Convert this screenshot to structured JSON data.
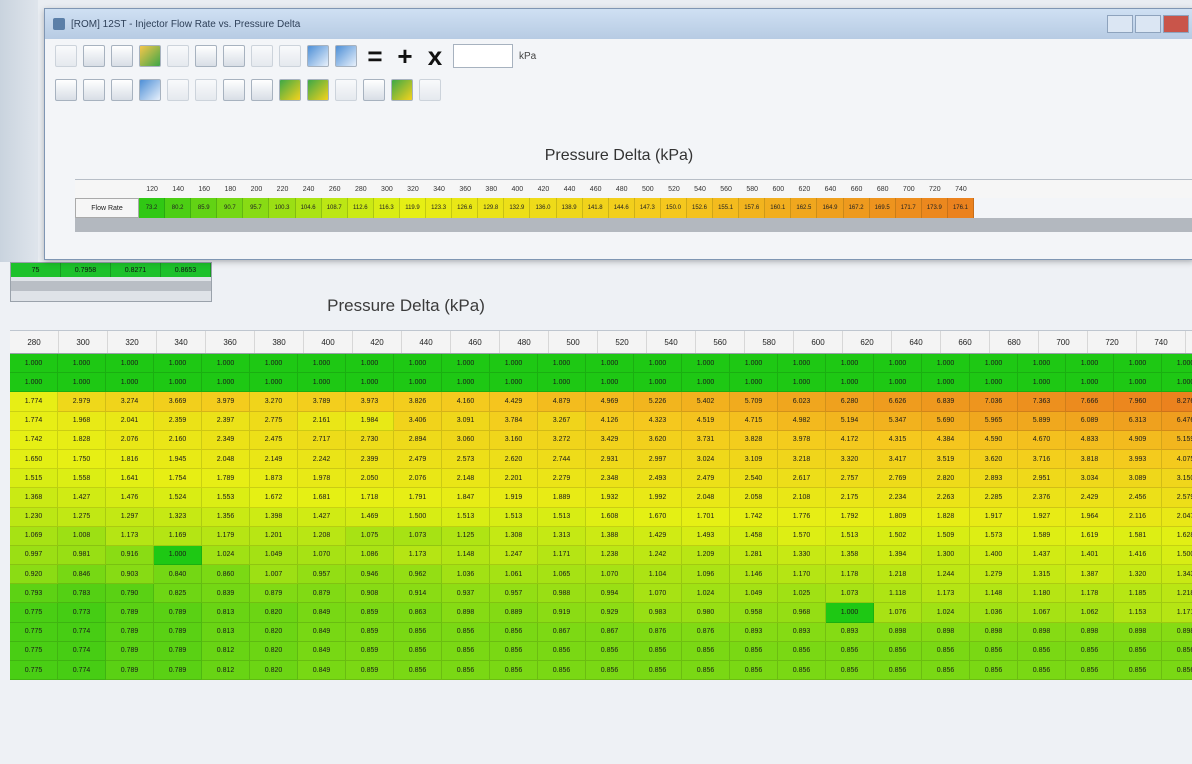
{
  "window": {
    "title": "[ROM] 12ST - Injector Flow Rate vs. Pressure Delta",
    "unit": "kPa",
    "table_title": "Pressure Delta (kPa)",
    "row_label": "Flow Rate",
    "columns": [
      "120",
      "140",
      "160",
      "180",
      "200",
      "220",
      "240",
      "260",
      "280",
      "300",
      "320",
      "340",
      "360",
      "380",
      "400",
      "420",
      "440",
      "460",
      "480",
      "500",
      "520",
      "540",
      "560",
      "580",
      "600",
      "620",
      "640",
      "660",
      "680",
      "700",
      "720",
      "740"
    ],
    "values": [
      "73.2",
      "80.2",
      "85.9",
      "90.7",
      "95.7",
      "100.3",
      "104.6",
      "108.7",
      "112.6",
      "116.3",
      "119.9",
      "123.3",
      "126.6",
      "129.8",
      "132.9",
      "136.0",
      "138.9",
      "141.8",
      "144.6",
      "147.3",
      "150.0",
      "152.6",
      "155.1",
      "157.6",
      "160.1",
      "162.5",
      "164.9",
      "167.2",
      "169.5",
      "171.7",
      "173.9",
      "176.1"
    ],
    "toolbar_operators": [
      "=",
      "+",
      "x"
    ]
  },
  "background": {
    "mini_values": [
      "75",
      "0.7958",
      "0.8271",
      "0.8653"
    ],
    "table_title": "Pressure Delta (kPa)",
    "columns": [
      "280",
      "300",
      "320",
      "340",
      "360",
      "380",
      "400",
      "420",
      "440",
      "460",
      "480",
      "500",
      "520",
      "540",
      "560",
      "580",
      "600",
      "620",
      "640",
      "660",
      "680",
      "700",
      "720",
      "740",
      "760"
    ],
    "rows": [
      [
        "1.000",
        "1.000",
        "1.000",
        "1.000",
        "1.000",
        "1.000",
        "1.000",
        "1.000",
        "1.000",
        "1.000",
        "1.000",
        "1.000",
        "1.000",
        "1.000",
        "1.000",
        "1.000",
        "1.000",
        "1.000",
        "1.000",
        "1.000",
        "1.000",
        "1.000",
        "1.000",
        "1.000",
        "1.000"
      ],
      [
        "1.000",
        "1.000",
        "1.000",
        "1.000",
        "1.000",
        "1.000",
        "1.000",
        "1.000",
        "1.000",
        "1.000",
        "1.000",
        "1.000",
        "1.000",
        "1.000",
        "1.000",
        "1.000",
        "1.000",
        "1.000",
        "1.000",
        "1.000",
        "1.000",
        "1.000",
        "1.000",
        "1.000",
        "1.000"
      ],
      [
        "1.774",
        "2.979",
        "3.274",
        "3.669",
        "3.979",
        "3.270",
        "3.789",
        "3.973",
        "3.826",
        "4.160",
        "4.429",
        "4.879",
        "4.969",
        "5.226",
        "5.402",
        "5.709",
        "6.023",
        "6.280",
        "6.626",
        "6.839",
        "7.036",
        "7.363",
        "7.666",
        "7.960",
        "8.276"
      ],
      [
        "1.774",
        "1.968",
        "2.041",
        "2.359",
        "2.397",
        "2.775",
        "2.161",
        "1.984",
        "3.406",
        "3.091",
        "3.784",
        "3.267",
        "4.126",
        "4.323",
        "4.519",
        "4.715",
        "4.982",
        "5.194",
        "5.347",
        "5.690",
        "5.965",
        "5.899",
        "6.089",
        "6.313",
        "6.476"
      ],
      [
        "1.742",
        "1.828",
        "2.076",
        "2.160",
        "2.349",
        "2.475",
        "2.717",
        "2.730",
        "2.894",
        "3.060",
        "3.160",
        "3.272",
        "3.429",
        "3.620",
        "3.731",
        "3.828",
        "3.978",
        "4.172",
        "4.315",
        "4.384",
        "4.590",
        "4.670",
        "4.833",
        "4.909",
        "5.159"
      ],
      [
        "1.650",
        "1.750",
        "1.816",
        "1.945",
        "2.048",
        "2.149",
        "2.242",
        "2.399",
        "2.479",
        "2.573",
        "2.620",
        "2.744",
        "2.931",
        "2.997",
        "3.024",
        "3.109",
        "3.218",
        "3.320",
        "3.417",
        "3.519",
        "3.620",
        "3.716",
        "3.818",
        "3.993",
        "4.075"
      ],
      [
        "1.515",
        "1.558",
        "1.641",
        "1.754",
        "1.789",
        "1.873",
        "1.978",
        "2.050",
        "2.076",
        "2.148",
        "2.201",
        "2.279",
        "2.348",
        "2.493",
        "2.479",
        "2.540",
        "2.617",
        "2.757",
        "2.769",
        "2.820",
        "2.893",
        "2.951",
        "3.034",
        "3.089",
        "3.150"
      ],
      [
        "1.368",
        "1.427",
        "1.476",
        "1.524",
        "1.553",
        "1.672",
        "1.681",
        "1.718",
        "1.791",
        "1.847",
        "1.919",
        "1.889",
        "1.932",
        "1.992",
        "2.048",
        "2.058",
        "2.108",
        "2.175",
        "2.234",
        "2.263",
        "2.285",
        "2.376",
        "2.429",
        "2.456",
        "2.579"
      ],
      [
        "1.230",
        "1.275",
        "1.297",
        "1.323",
        "1.356",
        "1.398",
        "1.427",
        "1.469",
        "1.500",
        "1.513",
        "1.513",
        "1.513",
        "1.608",
        "1.670",
        "1.701",
        "1.742",
        "1.776",
        "1.792",
        "1.809",
        "1.828",
        "1.917",
        "1.927",
        "1.964",
        "2.116",
        "2.047"
      ],
      [
        "1.069",
        "1.008",
        "1.173",
        "1.169",
        "1.179",
        "1.201",
        "1.208",
        "1.075",
        "1.073",
        "1.125",
        "1.308",
        "1.313",
        "1.388",
        "1.429",
        "1.493",
        "1.458",
        "1.570",
        "1.513",
        "1.502",
        "1.509",
        "1.573",
        "1.589",
        "1.619",
        "1.581",
        "1.628"
      ],
      [
        "0.997",
        "0.981",
        "0.916",
        "1.000",
        "1.024",
        "1.049",
        "1.070",
        "1.086",
        "1.173",
        "1.148",
        "1.247",
        "1.171",
        "1.238",
        "1.242",
        "1.209",
        "1.281",
        "1.330",
        "1.358",
        "1.394",
        "1.300",
        "1.400",
        "1.437",
        "1.401",
        "1.416",
        "1.500"
      ],
      [
        "0.920",
        "0.846",
        "0.903",
        "0.840",
        "0.860",
        "1.007",
        "0.957",
        "0.946",
        "0.962",
        "1.036",
        "1.061",
        "1.065",
        "1.070",
        "1.104",
        "1.096",
        "1.146",
        "1.170",
        "1.178",
        "1.218",
        "1.244",
        "1.279",
        "1.315",
        "1.387",
        "1.320",
        "1.343"
      ],
      [
        "0.793",
        "0.783",
        "0.790",
        "0.825",
        "0.839",
        "0.879",
        "0.879",
        "0.908",
        "0.914",
        "0.937",
        "0.957",
        "0.988",
        "0.994",
        "1.070",
        "1.024",
        "1.049",
        "1.025",
        "1.073",
        "1.118",
        "1.173",
        "1.148",
        "1.180",
        "1.178",
        "1.185",
        "1.218"
      ],
      [
        "0.775",
        "0.773",
        "0.789",
        "0.789",
        "0.813",
        "0.820",
        "0.849",
        "0.859",
        "0.863",
        "0.898",
        "0.889",
        "0.919",
        "0.929",
        "0.983",
        "0.980",
        "0.958",
        "0.968",
        "1.000",
        "1.076",
        "1.024",
        "1.036",
        "1.067",
        "1.062",
        "1.153",
        "1.171"
      ],
      [
        "0.775",
        "0.774",
        "0.789",
        "0.789",
        "0.813",
        "0.820",
        "0.849",
        "0.859",
        "0.856",
        "0.856",
        "0.856",
        "0.867",
        "0.867",
        "0.876",
        "0.876",
        "0.893",
        "0.893",
        "0.893",
        "0.898",
        "0.898",
        "0.898",
        "0.898",
        "0.898",
        "0.898",
        "0.898"
      ],
      [
        "0.775",
        "0.774",
        "0.789",
        "0.789",
        "0.812",
        "0.820",
        "0.849",
        "0.859",
        "0.856",
        "0.856",
        "0.856",
        "0.856",
        "0.856",
        "0.856",
        "0.856",
        "0.856",
        "0.856",
        "0.856",
        "0.856",
        "0.856",
        "0.856",
        "0.856",
        "0.856",
        "0.856",
        "0.856"
      ],
      [
        "0.775",
        "0.774",
        "0.789",
        "0.789",
        "0.812",
        "0.820",
        "0.849",
        "0.859",
        "0.856",
        "0.856",
        "0.856",
        "0.856",
        "0.856",
        "0.856",
        "0.856",
        "0.856",
        "0.856",
        "0.856",
        "0.856",
        "0.856",
        "0.856",
        "0.856",
        "0.856",
        "0.856",
        "0.856"
      ]
    ]
  }
}
